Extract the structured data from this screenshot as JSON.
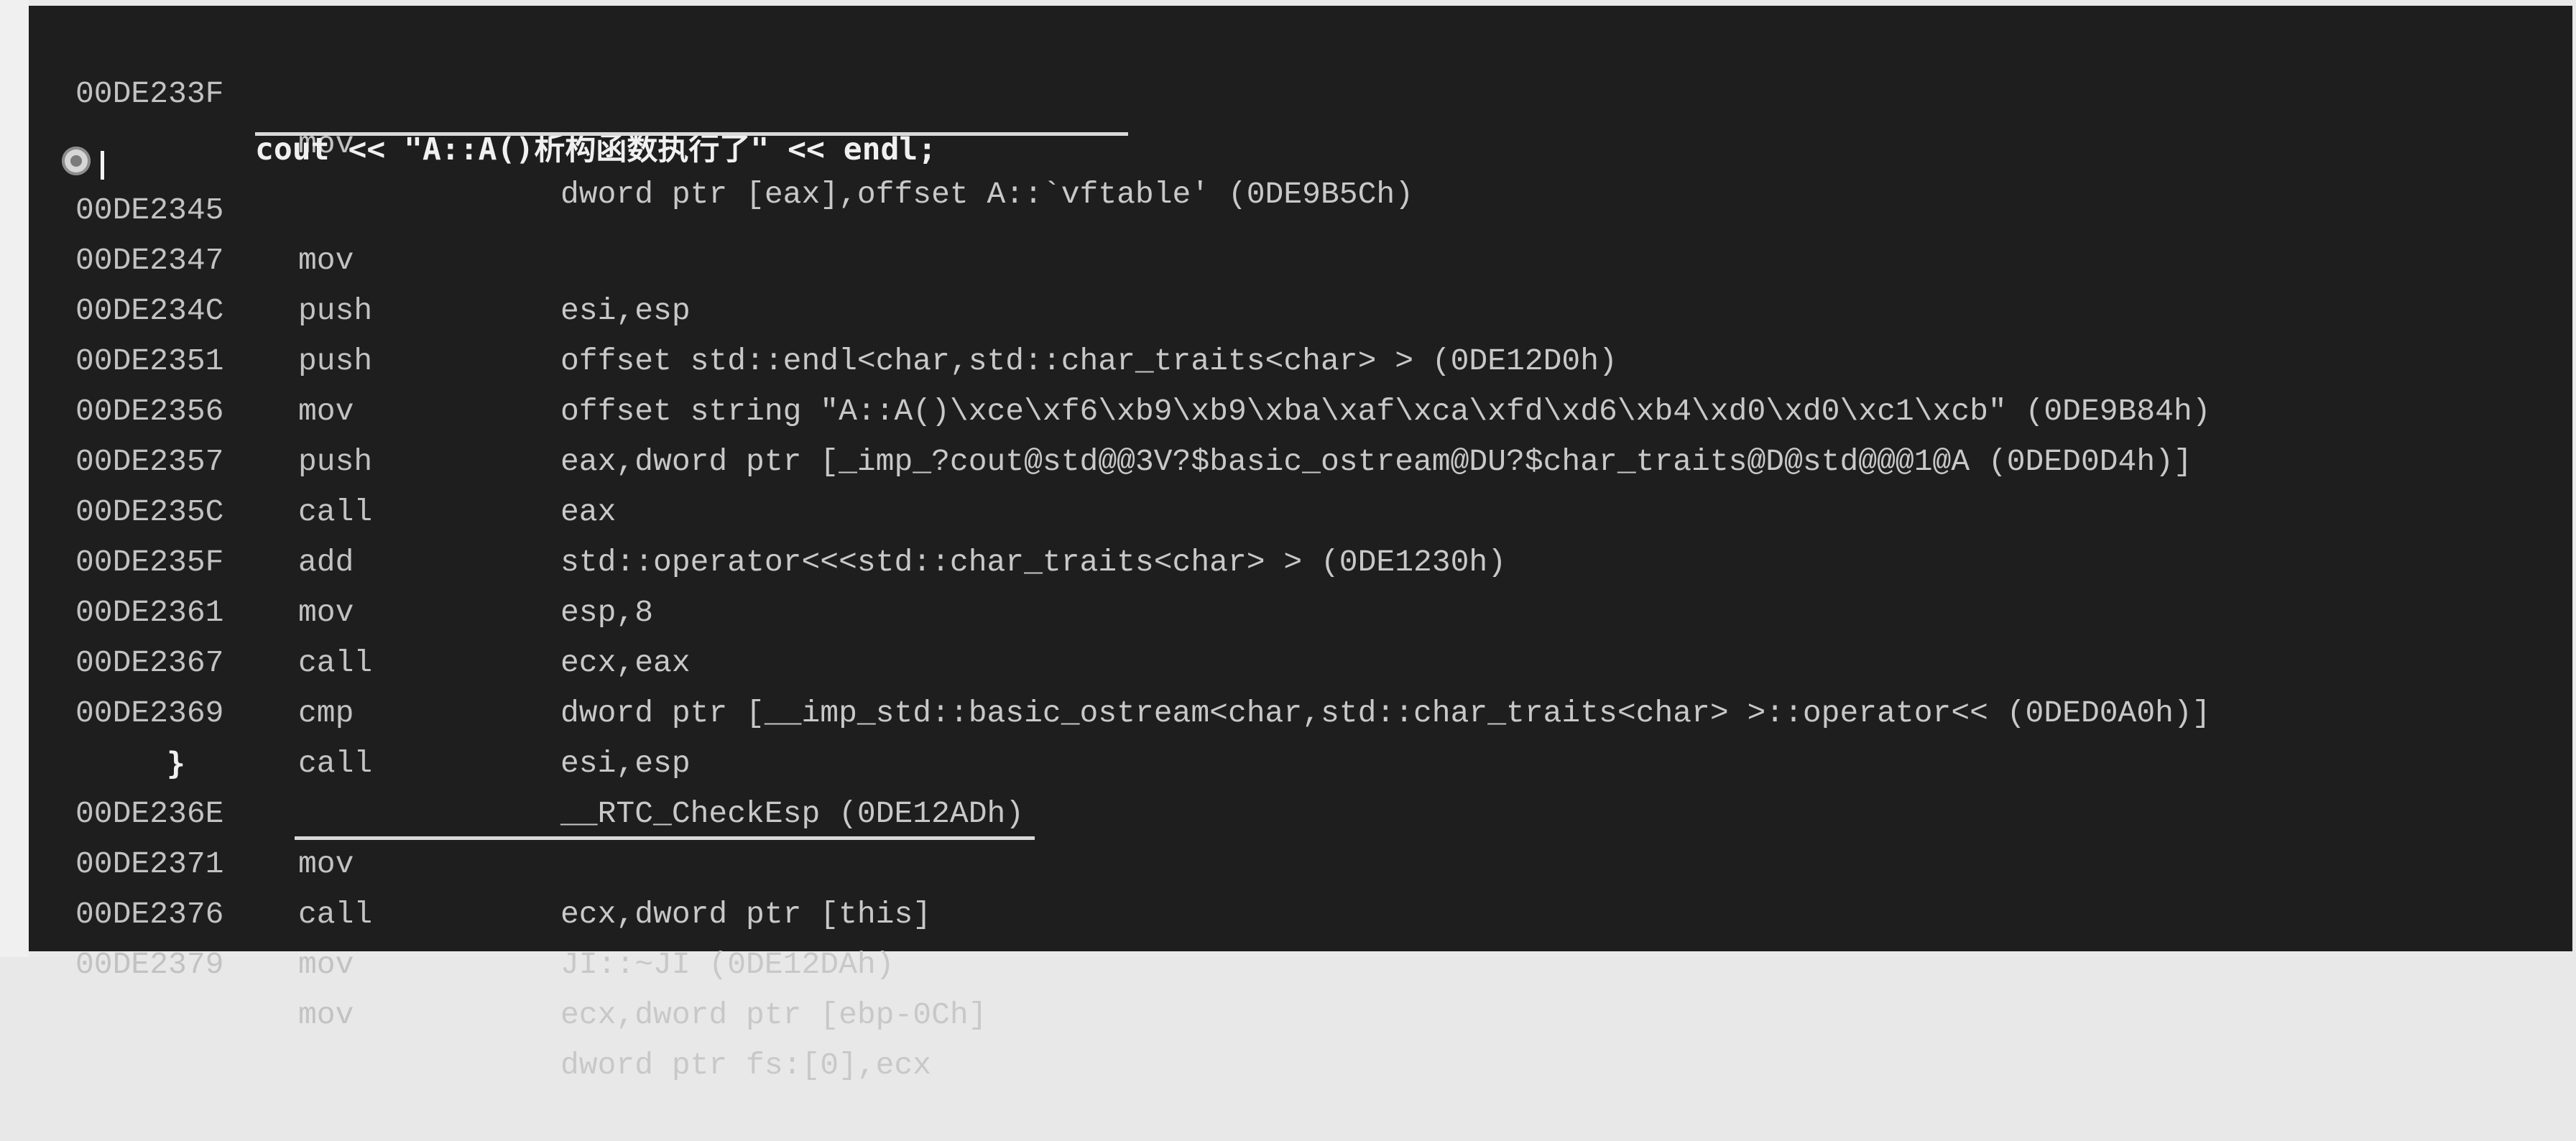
{
  "source_lines": [
    {
      "text": "cout << \"A::A()析构函数执行了\" << endl;"
    },
    {
      "text": "}"
    }
  ],
  "instructions": [
    {
      "addr": "00DE233F",
      "op": "mov",
      "args": "dword ptr [eax],offset A::`vftable' (0DE9B5Ch)"
    },
    {
      "addr": "00DE2345",
      "op": "mov",
      "args": "esi,esp"
    },
    {
      "addr": "00DE2347",
      "op": "push",
      "args": "offset std::endl<char,std::char_traits<char> > (0DE12D0h)"
    },
    {
      "addr": "00DE234C",
      "op": "push",
      "args": "offset string \"A::A()\\xce\\xf6\\xb9\\xb9\\xba\\xaf\\xca\\xfd\\xd6\\xb4\\xd0\\xd0\\xc1\\xcb\" (0DE9B84h)"
    },
    {
      "addr": "00DE2351",
      "op": "mov",
      "args": "eax,dword ptr [_imp_?cout@std@@3V?$basic_ostream@DU?$char_traits@D@std@@@1@A (0DED0D4h)]"
    },
    {
      "addr": "00DE2356",
      "op": "push",
      "args": "eax"
    },
    {
      "addr": "00DE2357",
      "op": "call",
      "args": "std::operator<<<std::char_traits<char> > (0DE1230h)"
    },
    {
      "addr": "00DE235C",
      "op": "add",
      "args": "esp,8"
    },
    {
      "addr": "00DE235F",
      "op": "mov",
      "args": "ecx,eax"
    },
    {
      "addr": "00DE2361",
      "op": "call",
      "args": "dword ptr [__imp_std::basic_ostream<char,std::char_traits<char> >::operator<< (0DED0A0h)]"
    },
    {
      "addr": "00DE2367",
      "op": "cmp",
      "args": "esi,esp"
    },
    {
      "addr": "00DE2369",
      "op": "call",
      "args": "__RTC_CheckEsp (0DE12ADh)"
    },
    {
      "addr": "00DE236E",
      "op": "mov",
      "args": "ecx,dword ptr [this]"
    },
    {
      "addr": "00DE2371",
      "op": "call",
      "args": "JI::~JI (0DE12DAh)"
    },
    {
      "addr": "00DE2376",
      "op": "mov",
      "args": "ecx,dword ptr [ebp-0Ch]"
    },
    {
      "addr": "00DE2379",
      "op": "mov",
      "args": "dword ptr fs:[0],ecx"
    }
  ]
}
